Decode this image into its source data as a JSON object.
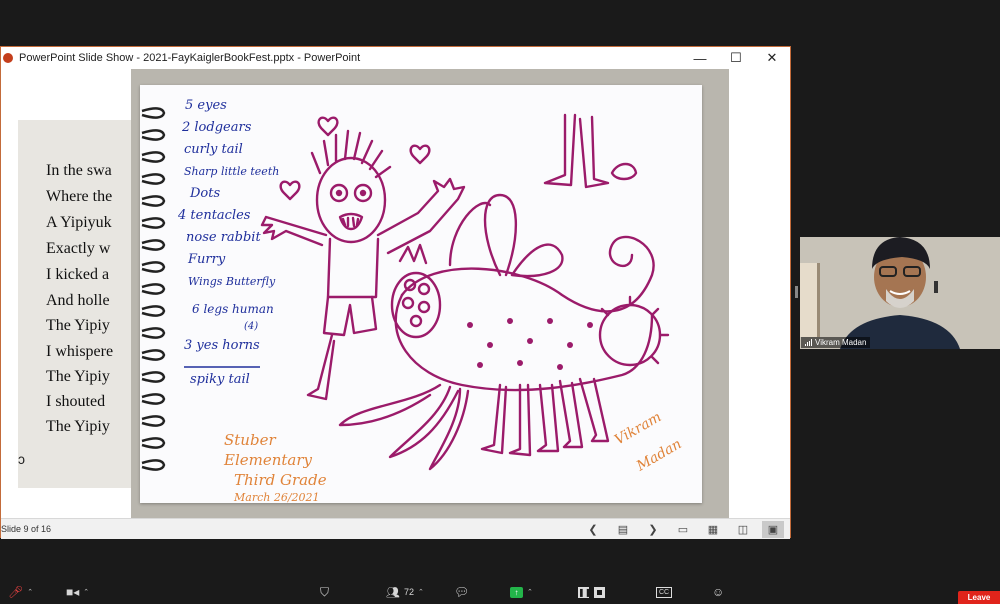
{
  "window": {
    "title": "PowerPoint Slide Show  -  2021-FayKaiglerBookFest.pptx - PowerPoint",
    "minimize": "—",
    "maximize": "☐",
    "close": "✕"
  },
  "book_text": [
    "In the swa",
    "Where the",
    "A Yipiyuk",
    "Exactly w",
    "I kicked a",
    "And holle",
    "The Yipiy",
    "I whispere",
    "The Yipiy",
    "I shouted",
    "The Yipiy"
  ],
  "drawing": {
    "features_list": [
      "5 eyes",
      "2 lodgears",
      "curly tail",
      "Sharp little teeth",
      "Dots",
      "4 tentacles",
      "nose rabbit",
      "Furry",
      "Wings Butterfly",
      "6 legs human",
      "(4)",
      "3 yes horns",
      "spiky tail"
    ],
    "school_note": [
      "Stuber",
      "Elementary",
      "Third Grade",
      "March 26/2021"
    ],
    "signature": [
      "Vikram",
      "Madan"
    ]
  },
  "statusbar": {
    "slide_count": "Slide 9 of 16"
  },
  "participant": {
    "name": "Vikram Madan"
  },
  "toolbar": {
    "participants_count": "72",
    "leave_label": "Leave"
  },
  "colors": {
    "ink": "#9b1b6a",
    "orange_ink": "#e0843a",
    "blue_ink": "#1f2f9c",
    "leave_red": "#e0241b",
    "ppt_border": "#c36b3a"
  }
}
